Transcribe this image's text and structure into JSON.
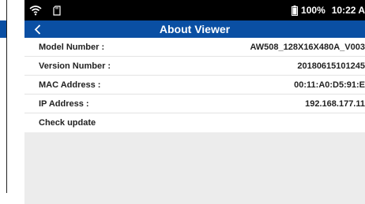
{
  "status_bar": {
    "battery_text": "100%",
    "time": "10:22 A"
  },
  "header": {
    "title": "About Viewer",
    "back_icon": "chevron-left-icon"
  },
  "info_rows": [
    {
      "label": "Model Number :",
      "value": "AW508_128X16X480A_V003"
    },
    {
      "label": "Version Number :",
      "value": "20180615101245"
    },
    {
      "label": "MAC Address :",
      "value": "00:11:A0:D5:91:E"
    },
    {
      "label": "IP Address :",
      "value": "192.168.177.11"
    }
  ],
  "check_update": {
    "label": "Check update"
  },
  "colors": {
    "accent": "#0a4fa3",
    "status_bar": "#000000",
    "content_bg": "#ececec"
  }
}
